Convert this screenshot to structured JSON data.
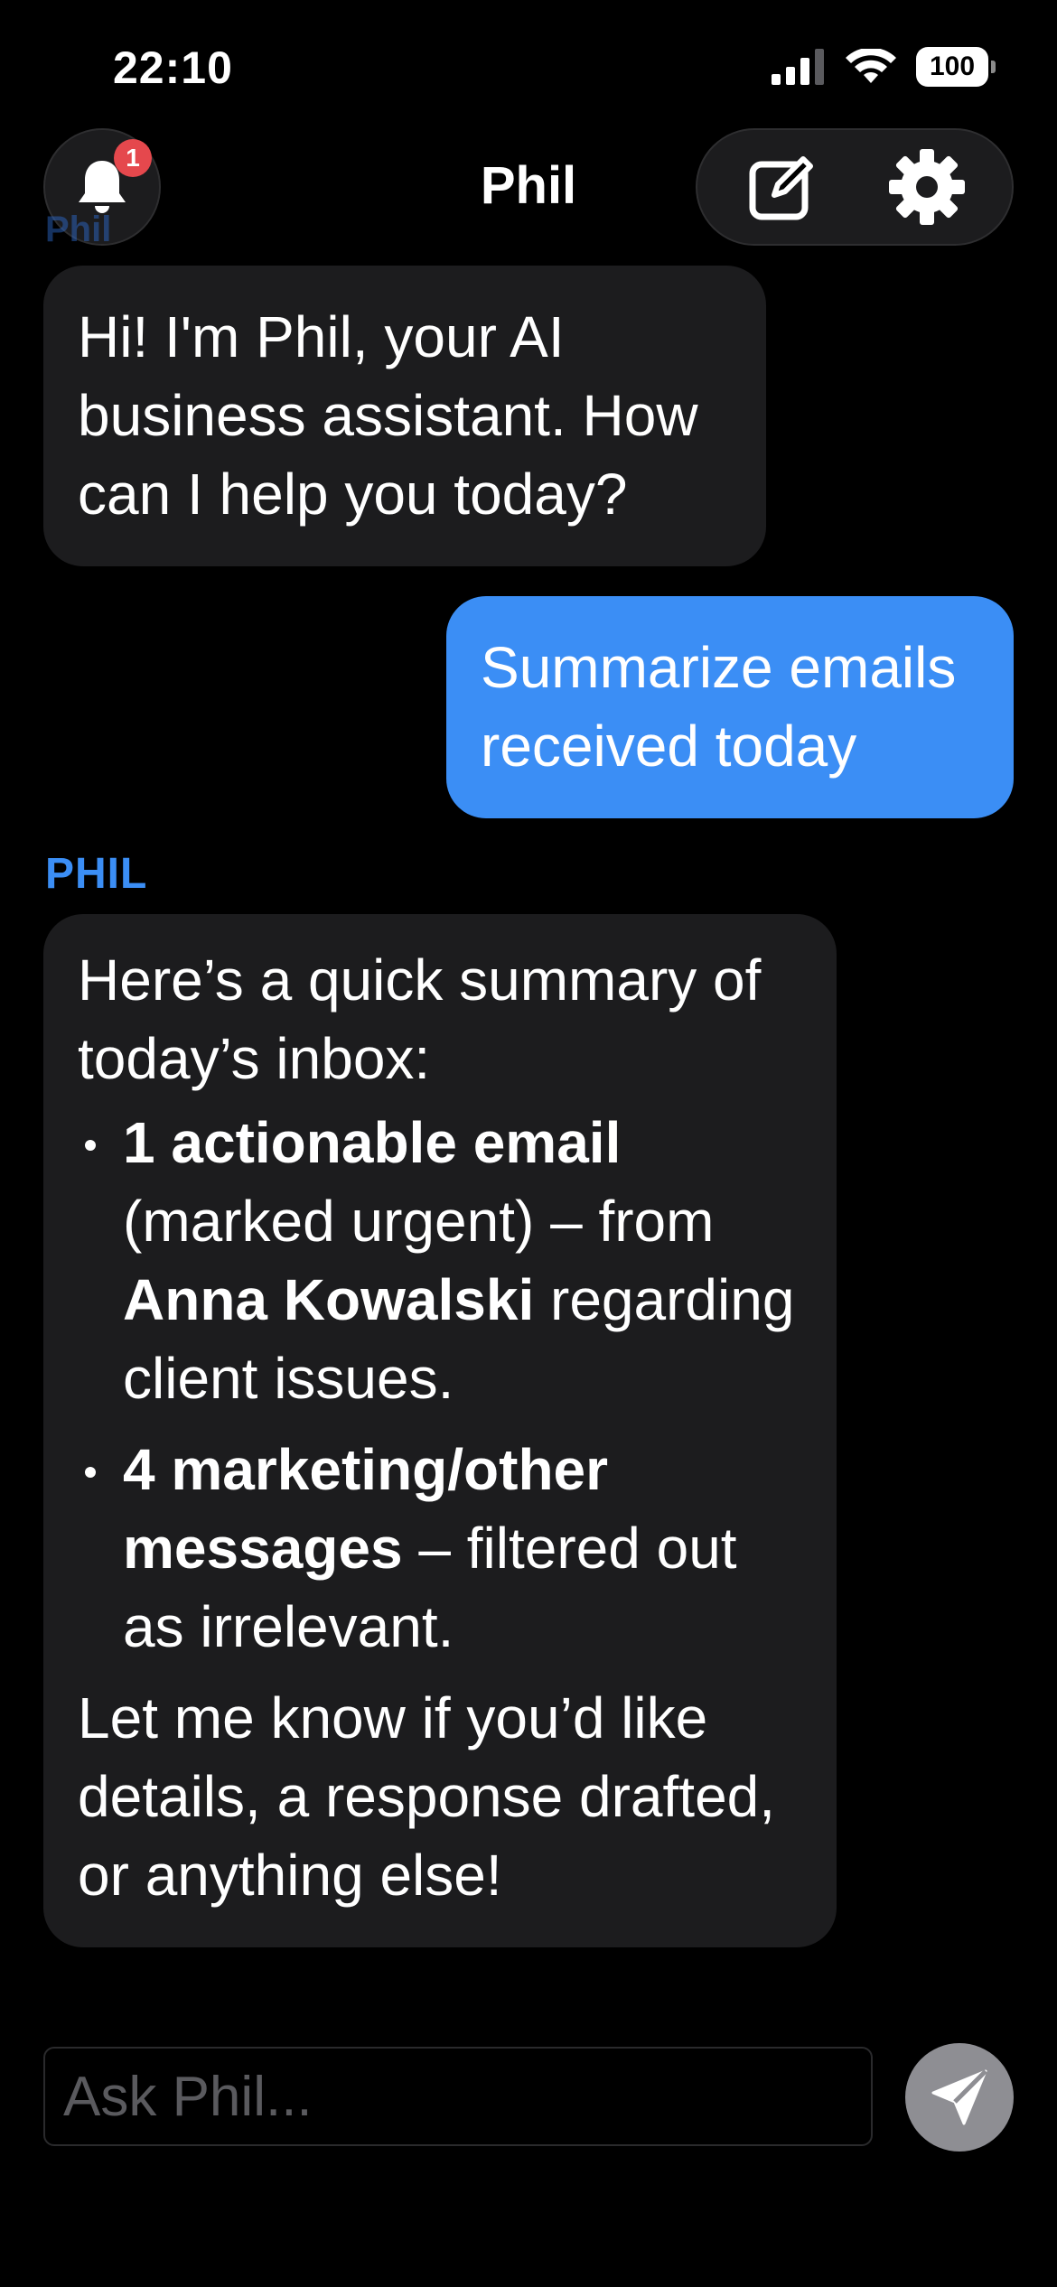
{
  "status_bar": {
    "time": "22:10",
    "battery": "100"
  },
  "header": {
    "title": "Phil",
    "notification_count": "1"
  },
  "messages": {
    "m1": {
      "text": "Hi! I'm Phil, your AI business assistant. How can I help you today?"
    },
    "m2": {
      "text": "Summarize emails received today"
    },
    "m3": {
      "sender": "PHIL",
      "intro": "Here’s a quick summary of today’s inbox:",
      "b1_bold": "1 actionable email",
      "b1_text1": " (marked urgent) – from ",
      "b1_bold2": "Anna Kowalski",
      "b1_text2": " regarding client issues.",
      "b2_bold": "4 marketing/other messages",
      "b2_text": " – filtered out as irrelevant.",
      "outro": "Let me know if you’d like details, a response drafted, or anything else!"
    }
  },
  "composer": {
    "placeholder": "Ask Phil..."
  },
  "colors": {
    "background": "#000000",
    "ai_bubble": "#1c1c1e",
    "user_bubble": "#3b8ef5",
    "accent": "#3b8ef5",
    "badge": "#e5484d",
    "send_button": "#8e8e93"
  },
  "icons": {
    "bell": "bell-icon",
    "compose": "compose-icon",
    "settings": "gear-icon",
    "send": "send-icon",
    "signal": "signal-icon",
    "wifi": "wifi-icon",
    "battery": "battery-icon"
  }
}
